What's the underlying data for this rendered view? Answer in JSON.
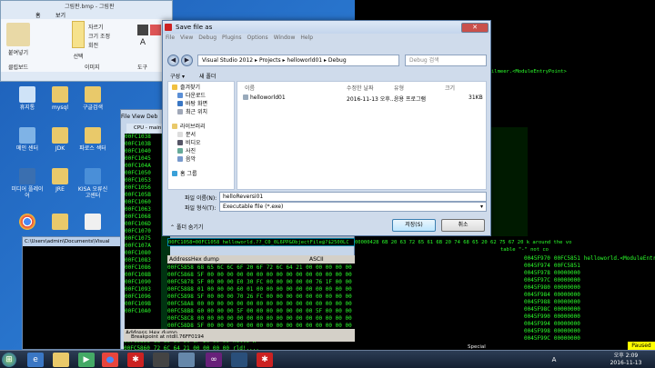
{
  "paint": {
    "title": "그림판.bmp - 그림판",
    "tabs": [
      "홈",
      "보기"
    ],
    "groups": {
      "clipboard": "클립보드",
      "image": "이미지",
      "tools": "도구"
    },
    "paste": "붙여넣기",
    "crop": "자르기",
    "resize": "크기 조정",
    "rotate": "회전",
    "select": "선택"
  },
  "desktop_icons": [
    {
      "label": "휴지통"
    },
    {
      "label": "mysql"
    },
    {
      "label": "구글검색"
    },
    {
      "label": "메인 센터"
    },
    {
      "label": "JDK"
    },
    {
      "label": "파로스 섹터"
    },
    {
      "label": "미디어 플레이어"
    },
    {
      "label": "JRE"
    },
    {
      "label": "KISA 오류신고센터"
    }
  ],
  "cmd": {
    "title": "C:\\Users\\admin\\Documents\\Visual"
  },
  "olly": {
    "title": "CPU - main thread",
    "menu": [
      "File",
      "View",
      "Deb"
    ],
    "addresses": [
      "00FC1038",
      "00FC103B",
      "00FC1040",
      "00FC1045",
      "00FC104A",
      "00FC1050",
      "00FC1053",
      "00FC1056",
      "00FC105B",
      "00FC1060",
      "00FC1063",
      "00FC1068",
      "00FC106D",
      "00FC1070",
      "00FC1075",
      "00FC107A",
      "00FC1080",
      "00FC1083",
      "00FC1086",
      "00FC108B",
      "00FC1090",
      "00FC1093",
      "00FC1096",
      "00FC109B",
      "00FC10A0"
    ],
    "info_line": "00FC1058=00FC1058 helloworld.??_C0_0L6PP&ObjectFile@?$2500LC",
    "dump_header": {
      "address": "Address",
      "hex": "Hex dump",
      "ascii": "ASCII"
    },
    "dump_rows": [
      {
        "addr": "00FC5858",
        "hex": "68 65 6C 6C 6F 20 6F 72 6C 64 21 00 00 00 00 00",
        "ascii": "hello W"
      },
      {
        "addr": "00FC5868",
        "hex": "5F 00 00 00 00 00 00 00 00 00 00 00 00 00 00 00",
        "ascii": "_......"
      },
      {
        "addr": "00FC5878",
        "hex": "5F 00 00 00 E0 30 FC 00 00 00 00 00 76 1F 00 00",
        "ascii": "_......"
      },
      {
        "addr": "00FC5888",
        "hex": "01 00 00 00 60 01 00 00 00 00 00 00 00 00 00 00",
        "ascii": "........"
      },
      {
        "addr": "00FC5898",
        "hex": "5F 00 00 00 70 26 FC 00 00 00 00 00 00 00 00 00",
        "ascii": "_..p&..."
      },
      {
        "addr": "00FC58A8",
        "hex": "00 00 00 00 00 00 00 00 00 00 00 00 00 00 00 00",
        "ascii": "........"
      },
      {
        "addr": "00FC58B8",
        "hex": "60 00 00 00 5F 00 00 00 00 00 00 00 5F 00 00 00",
        "ascii": "`..._..."
      },
      {
        "addr": "00FC58C8",
        "hex": "00 00 00 00 00 00 00 00 00 00 00 00 00 00 00 00",
        "ascii": "........"
      },
      {
        "addr": "00FC58D8",
        "hex": "5F 00 00 00 00 00 00 00 00 00 00 00 00 00 00 00",
        "ascii": "_......."
      },
      {
        "addr": "00FC58E8",
        "hex": "00 00 00 00 00 00 00 00 00 00 00 00 00 00 00 00",
        "ascii": "........"
      },
      {
        "addr": "00FC58F8",
        "hex": "00 00 00 00 00 00 00 00 00 00 00 00 00 00 00 00",
        "ascii": "........"
      }
    ],
    "bottom_rows": [
      {
        "addr": "00FC5858",
        "hex": "68 65 6C 6C 6F 20 00 00",
        "ascii": "hello W"
      },
      {
        "addr": "00FC5860",
        "hex": "72 6C 64 21 00 00 00 00",
        "ascii": "rld!...."
      }
    ],
    "status": "Breakpoint at ntdll.76FF0194"
  },
  "stack": {
    "rows": [
      {
        "addr": "0045F970",
        "val": "00FC5851",
        "comment": "helloworld.<ModuleEntryPoint>"
      },
      {
        "addr": "0045F974",
        "val": "00FC5851",
        "comment": ""
      },
      {
        "addr": "0045F978",
        "val": "00000000",
        "comment": ""
      },
      {
        "addr": "0045F97C",
        "val": "00000000",
        "comment": ""
      },
      {
        "addr": "0045F980",
        "val": "00000000",
        "comment": ""
      },
      {
        "addr": "0045F984",
        "val": "00000000",
        "comment": ""
      },
      {
        "addr": "0045F988",
        "val": "00000000",
        "comment": ""
      },
      {
        "addr": "0045F98C",
        "val": "00000000",
        "comment": ""
      },
      {
        "addr": "0045F990",
        "val": "00000000",
        "comment": ""
      },
      {
        "addr": "0045F994",
        "val": "00000000",
        "comment": ""
      },
      {
        "addr": "0045F998",
        "val": "00000000",
        "comment": ""
      },
      {
        "addr": "0045F99C",
        "val": "00000000",
        "comment": ""
      }
    ],
    "top_text": "ilmeer.<ModuleEntryPoint>",
    "hex_right": "00000428 6B 20 63 72 65 61 6B 20 74 68 65 20 62 75 67 20 k around the vo",
    "hex_right2": "table \"-\" not co",
    "paused": "Paused",
    "special": "Special"
  },
  "dialog": {
    "title": "Save file as",
    "menu": [
      "File",
      "View",
      "Debug",
      "Plugins",
      "Options",
      "Window",
      "Help"
    ],
    "breadcrumb": [
      "Visual Studio 2012",
      "Projects",
      "helloworld01",
      "Debug"
    ],
    "search_placeholder": "Debug 검색",
    "organize": "구성 ▾",
    "new_folder": "새 폴더",
    "sidebar": {
      "favorites": "즐겨찾기",
      "fav_items": [
        "다운로드",
        "바탕 화면",
        "최근 위치"
      ],
      "libraries": "라이브러리",
      "lib_items": [
        "문서",
        "비디오",
        "사진",
        "음악"
      ],
      "homegroup": "홈 그룹"
    },
    "columns": [
      "이름",
      "수정한 날짜",
      "유형",
      "크기"
    ],
    "file": {
      "name": "helloworld01",
      "date": "2016-11-13 오후...",
      "type": "응용 프로그램",
      "size": "31KB"
    },
    "filename_label": "파일 이름(N):",
    "filename_value": "helloReversi01",
    "filetype_label": "파일 형식(T):",
    "filetype_value": "Executable file (*.exe)",
    "hide_folders": "폴더 숨기기",
    "save": "저장(S)",
    "cancel": "취소"
  },
  "taskbar": {
    "time": "오후 2:09",
    "date": "2016-11-13",
    "lang": "A"
  }
}
